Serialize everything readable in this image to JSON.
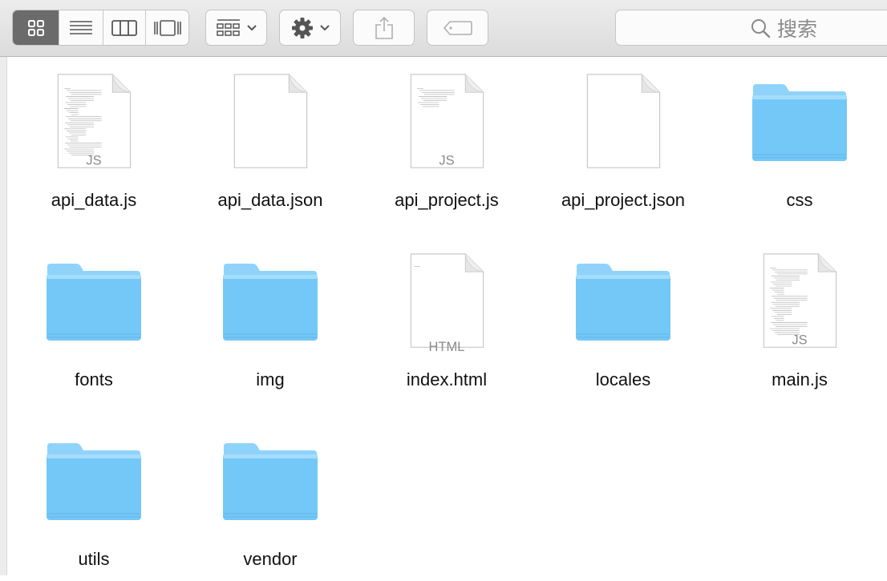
{
  "toolbar": {
    "view_buttons": [
      {
        "name": "icon-view",
        "icon": "grid-icon",
        "active": true
      },
      {
        "name": "list-view",
        "icon": "list-icon",
        "active": false
      },
      {
        "name": "column-view",
        "icon": "columns-icon",
        "active": false
      },
      {
        "name": "cover-flow-view",
        "icon": "coverflow-icon",
        "active": false
      }
    ],
    "arrange_icon": "arrange-icon",
    "action_icon": "gear-icon",
    "share_icon": "share-icon",
    "tags_icon": "tag-icon",
    "search_placeholder": "搜索"
  },
  "files": [
    {
      "name": "api_data.js",
      "kind": "js-doc",
      "badge": "JS"
    },
    {
      "name": "api_data.json",
      "kind": "blank-doc",
      "badge": ""
    },
    {
      "name": "api_project.js",
      "kind": "js-doc-sparse",
      "badge": "JS"
    },
    {
      "name": "api_project.json",
      "kind": "blank-doc",
      "badge": ""
    },
    {
      "name": "css",
      "kind": "folder",
      "badge": ""
    },
    {
      "name": "fonts",
      "kind": "folder",
      "badge": ""
    },
    {
      "name": "img",
      "kind": "folder",
      "badge": ""
    },
    {
      "name": "index.html",
      "kind": "html-doc",
      "badge": "HTML"
    },
    {
      "name": "locales",
      "kind": "folder",
      "badge": ""
    },
    {
      "name": "main.js",
      "kind": "js-doc",
      "badge": "JS"
    },
    {
      "name": "utils",
      "kind": "folder",
      "badge": ""
    },
    {
      "name": "vendor",
      "kind": "folder",
      "badge": ""
    }
  ],
  "colors": {
    "folder_top": "#8fd3fb",
    "folder_body": "#74c8f7",
    "active_segment": "#6b6b6b"
  }
}
